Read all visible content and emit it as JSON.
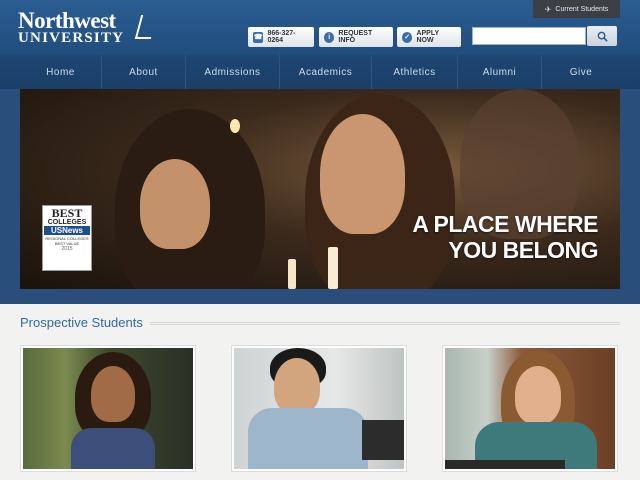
{
  "header": {
    "logo_top": "Northwest",
    "logo_bottom": "UNIVERSITY",
    "current_students": "Current Students",
    "phone": "866-327-0264",
    "request_info": "REQUEST INFO",
    "apply_now": "APPLY NOW",
    "search_placeholder": ""
  },
  "nav": {
    "items": [
      {
        "label": "Home"
      },
      {
        "label": "About"
      },
      {
        "label": "Admissions"
      },
      {
        "label": "Academics"
      },
      {
        "label": "Athletics"
      },
      {
        "label": "Alumni"
      },
      {
        "label": "Give"
      }
    ]
  },
  "hero": {
    "tagline_line1": "A PLACE WHERE",
    "tagline_line2": "YOU BELONG",
    "badge": {
      "line1": "BEST",
      "line2": "COLLEGES",
      "line3": "USNews",
      "line4": "REGIONAL COLLEGES BEST VALUE",
      "line5": "2015"
    }
  },
  "section": {
    "title": "Prospective Students"
  },
  "colors": {
    "header": "#2a5d92",
    "nav": "#1d4774",
    "accent": "#2f6aa5"
  }
}
